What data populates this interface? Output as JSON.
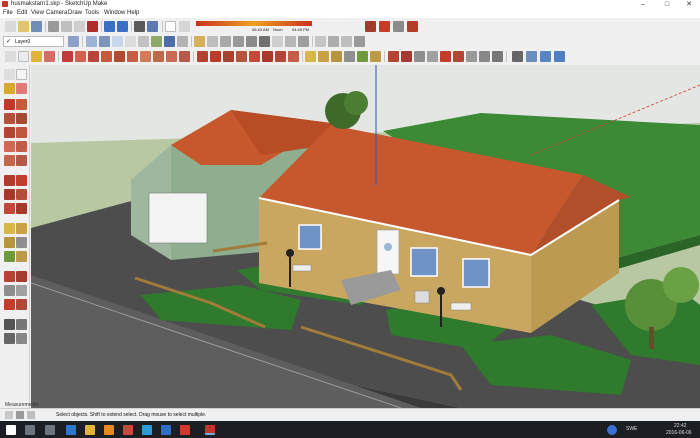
{
  "window": {
    "title": "husmakstarn1.skp - SketchUp Make"
  },
  "menu": [
    "File",
    "Edit",
    "View",
    "Camera",
    "Draw",
    "Tools",
    "Window",
    "Help"
  ],
  "shadow_bar": {
    "time": "06:43 AM",
    "noon": "Noon",
    "evening": "04:45 PM"
  },
  "layer": {
    "value": "Layer0",
    "checked": true
  },
  "status": {
    "measurements_label": "Measurements",
    "hint": "Select objects. Shift to extend select. Drag mouse to select multiple."
  },
  "tray": {
    "language": "SWE",
    "time": "22:42",
    "date": "2016-06-06"
  },
  "colors": {
    "sky": "#e3e6e3",
    "ground": "#b8c8a3",
    "roof": "#c7572c",
    "brick": "#c9a760",
    "lawn": "#2f7a2d",
    "pavement": "#4d4d4d"
  }
}
